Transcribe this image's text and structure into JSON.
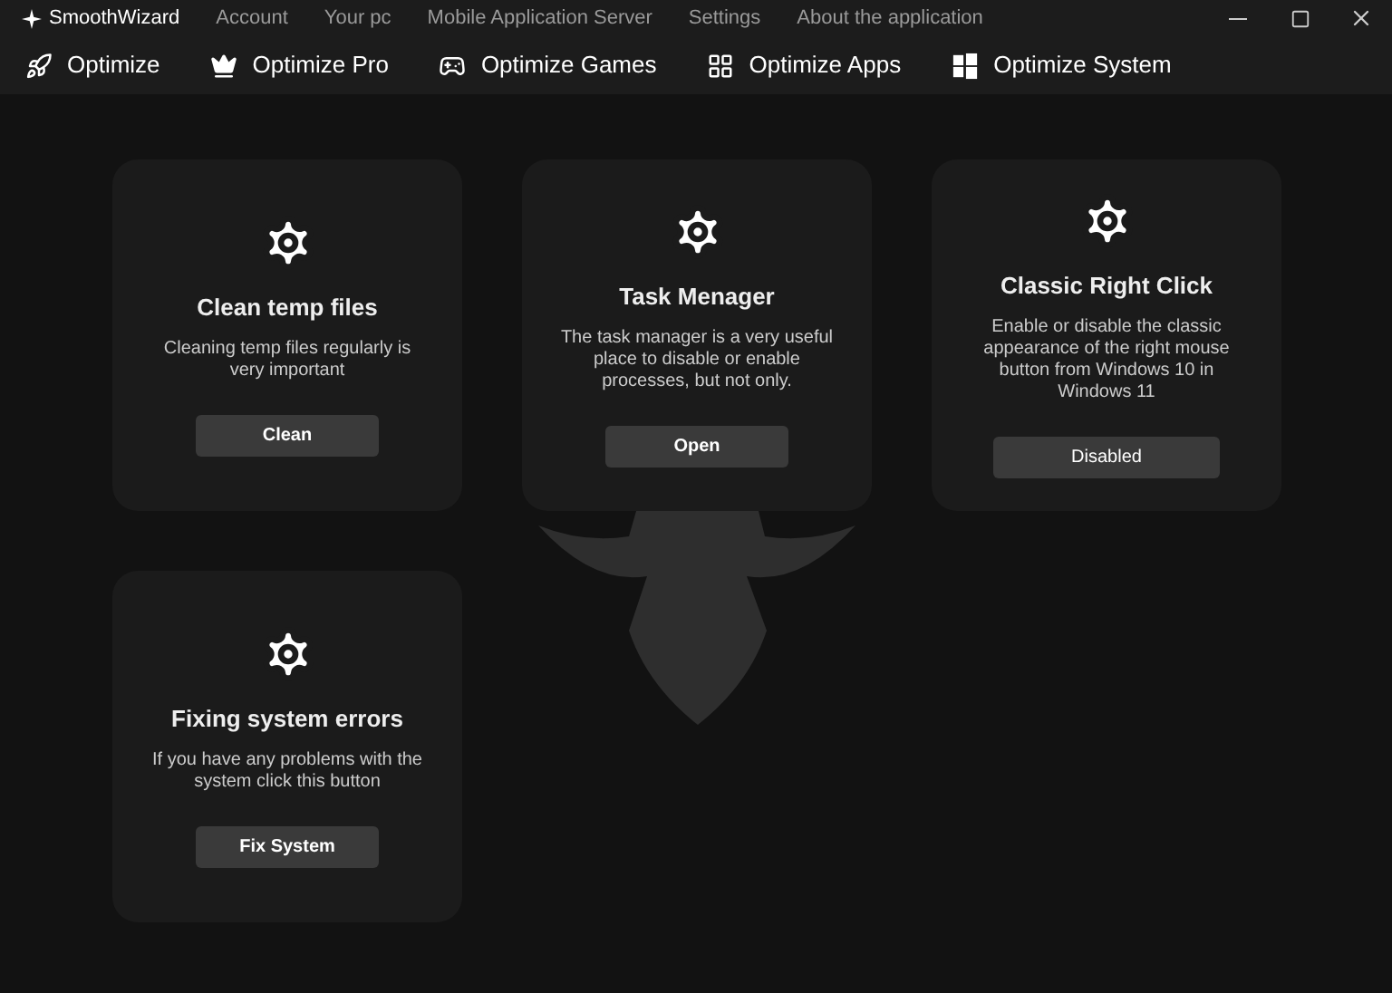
{
  "app": {
    "name": "SmoothWizard"
  },
  "menu": [
    "Account",
    "Your pc",
    "Mobile Application Server",
    "Settings",
    "About the application"
  ],
  "nav": [
    {
      "label": "Optimize",
      "kind": "rocket"
    },
    {
      "label": "Optimize Pro",
      "kind": "crown"
    },
    {
      "label": "Optimize Games",
      "kind": "gamepad"
    },
    {
      "label": "Optimize Apps",
      "kind": "apps"
    },
    {
      "label": "Optimize System",
      "kind": "windows"
    }
  ],
  "cards": [
    {
      "title": "Clean temp files",
      "description": "Cleaning temp files regularly is very important",
      "button": {
        "label": "Clean",
        "kind": "action"
      }
    },
    {
      "title": "Task Menager",
      "description": "The task manager is a very useful place to disable or enable processes, but not only.",
      "button": {
        "label": "Open",
        "kind": "action"
      }
    },
    {
      "title": "Classic Right Click",
      "description": "Enable or disable the classic appearance of the right mouse button from Windows 10 in Windows 11",
      "button": {
        "label": "Disabled",
        "kind": "toggle"
      }
    },
    {
      "title": "Fixing system errors",
      "description": "If you have any problems with the system click this button",
      "button": {
        "label": "Fix System",
        "kind": "action"
      }
    }
  ]
}
